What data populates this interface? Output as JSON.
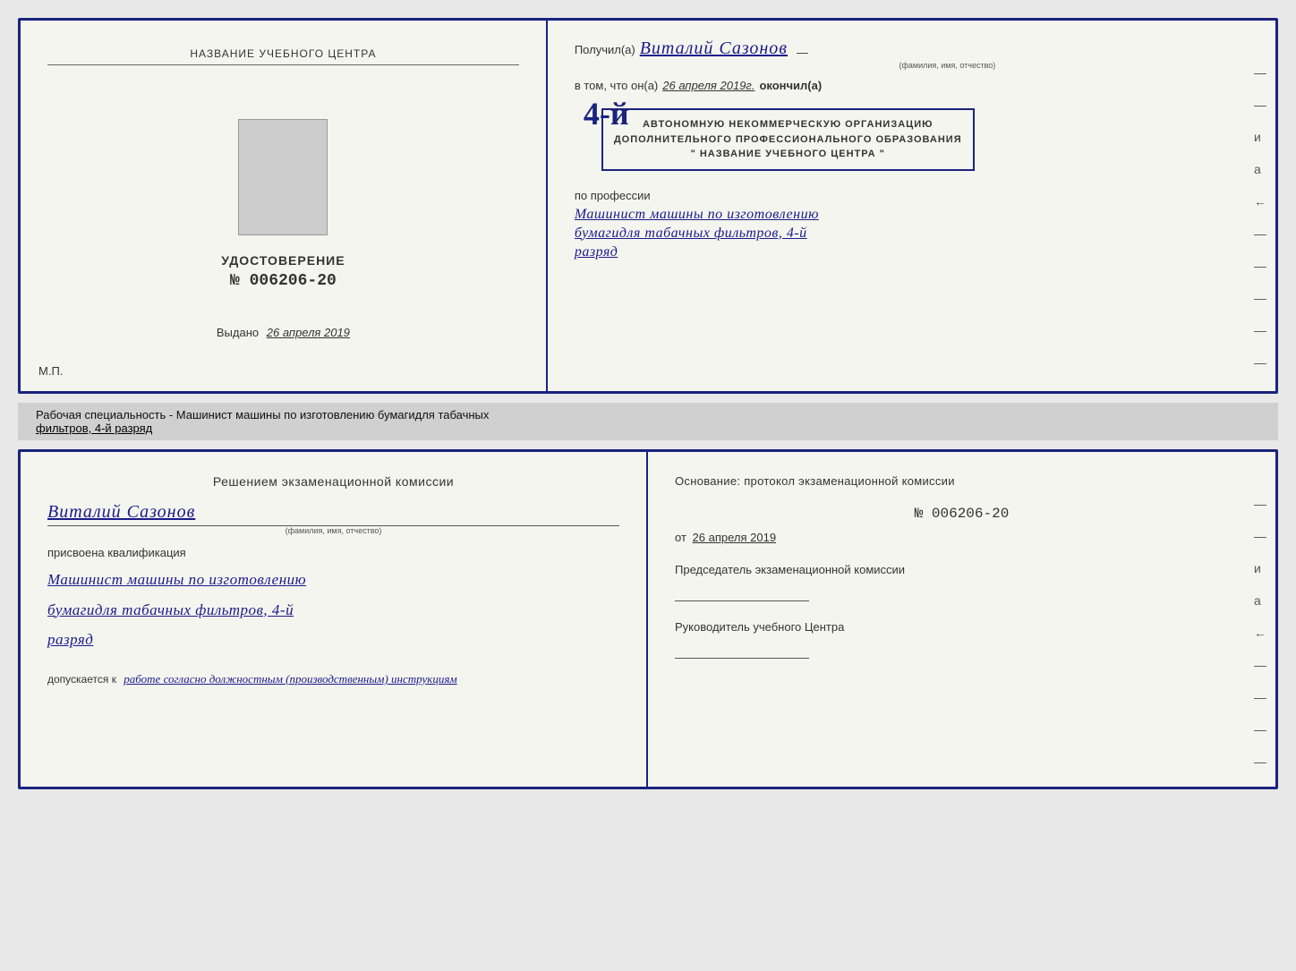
{
  "certificate": {
    "left": {
      "training_center_label": "НАЗВАНИЕ УЧЕБНОГО ЦЕНТРА",
      "title": "УДОСТОВЕРЕНИЕ",
      "number": "№ 006206-20",
      "issued_label": "Выдано",
      "issued_date": "26 апреля 2019",
      "mp_label": "М.П."
    },
    "right": {
      "recipient_prefix": "Получил(а)",
      "recipient_name": "Виталий Сазонов",
      "recipient_subtitle": "(фамилия, имя, отчество)",
      "confirm_prefix": "в том, что он(а)",
      "confirm_date": "26 апреля 2019г.",
      "confirm_suffix": "окончил(а)",
      "stamp_number": "4-й",
      "org_line1": "АВТОНОМНУЮ НЕКОММЕРЧЕСКУЮ ОРГАНИЗАЦИЮ",
      "org_line2": "ДОПОЛНИТЕЛЬНОГО ПРОФЕССИОНАЛЬНОГО ОБРАЗОВАНИЯ",
      "org_line3": "\" НАЗВАНИЕ УЧЕБНОГО ЦЕНТРА \"",
      "profession_label": "по профессии",
      "profession_line1": "Машинист машины по изготовлению",
      "profession_line2": "бумагидля табачных фильтров, 4-й",
      "profession_line3": "разряд"
    }
  },
  "annotation": {
    "text": "Рабочая специальность - Машинист машины по изготовлению бумагидля табачных",
    "underlined": "фильтров, 4-й разряд"
  },
  "qualification": {
    "left": {
      "section_title": "Решением экзаменационной комиссии",
      "person_name": "Виталий Сазонов",
      "name_subtitle": "(фамилия, имя, отчество)",
      "assigned_text": "присвоена квалификация",
      "qualification_line1": "Машинист машины по изготовлению",
      "qualification_line2": "бумагидля табачных фильтров, 4-й",
      "qualification_line3": "разряд",
      "allow_prefix": "допускается к",
      "allow_text": "работе согласно должностным (производственным) инструкциям"
    },
    "right": {
      "basis_text": "Основание: протокол экзаменационной комиссии",
      "protocol_number": "№ 006206-20",
      "ot_prefix": "от",
      "protocol_date": "26 апреля 2019",
      "chairman_label": "Председатель экзаменационной комиссии",
      "director_label": "Руководитель учебного Центра"
    }
  }
}
